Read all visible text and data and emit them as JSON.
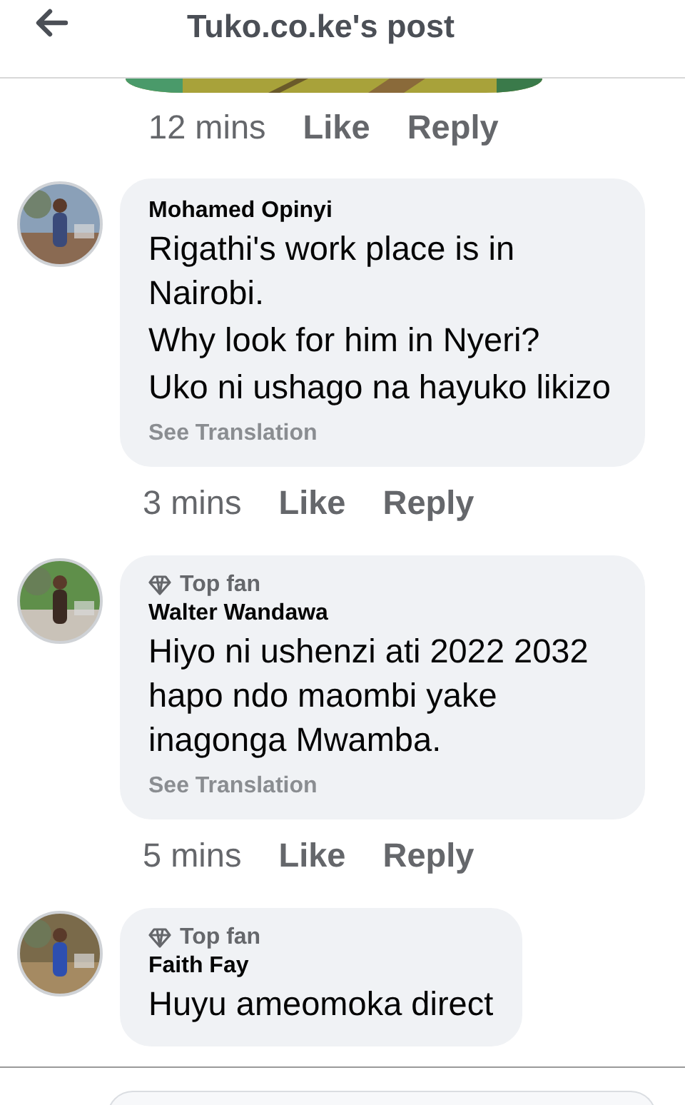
{
  "header": {
    "title": "Tuko.co.ke's post"
  },
  "previous_comment": {
    "time": "12 mins",
    "like": "Like",
    "reply": "Reply"
  },
  "comments": [
    {
      "author": "Mohamed Opinyi",
      "paragraphs": [
        "Rigathi's work place is in Nairobi.",
        "Why look for him in Nyeri?",
        "Uko ni ushago na hayuko likizo"
      ],
      "see_translation": "See Translation",
      "time": "3 mins",
      "like": "Like",
      "reply": "Reply"
    },
    {
      "badge": "Top fan",
      "author": "Walter Wandawa",
      "paragraphs": [
        "Hiyo ni ushenzi ati 2022 2032 hapo ndo maombi yake inagonga Mwamba."
      ],
      "see_translation": "See Translation",
      "time": "5 mins",
      "like": "Like",
      "reply": "Reply"
    },
    {
      "badge": "Top fan",
      "author": "Faith Fay",
      "paragraphs": [
        "Huyu ameomoka direct"
      ]
    }
  ]
}
